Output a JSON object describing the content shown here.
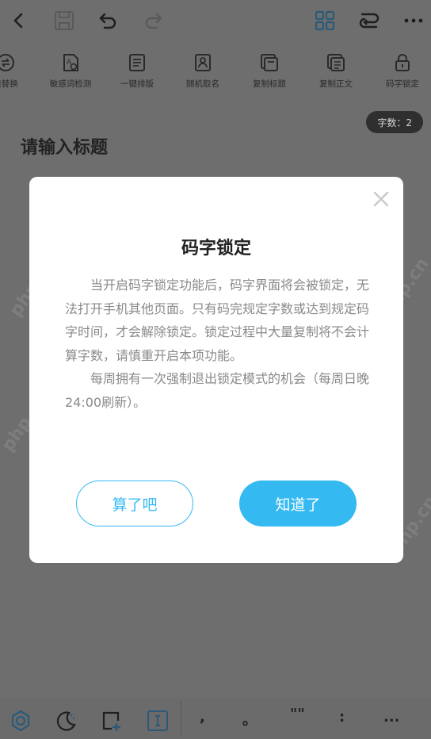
{
  "toolbar": {
    "items": [
      {
        "label": "能替换",
        "icon": "replace-icon"
      },
      {
        "label": "敏感词检测",
        "icon": "sensitive-word-icon"
      },
      {
        "label": "一键排版",
        "icon": "format-icon"
      },
      {
        "label": "随机取名",
        "icon": "random-name-icon"
      },
      {
        "label": "复制标题",
        "icon": "copy-title-icon"
      },
      {
        "label": "复制正文",
        "icon": "copy-body-icon"
      },
      {
        "label": "码字锁定",
        "icon": "lock-icon"
      }
    ]
  },
  "editor": {
    "word_count": "字数：2",
    "title_placeholder": "请输入标题"
  },
  "watermark": "php.cn",
  "dialog": {
    "title": "码字锁定",
    "paragraph1": "当开启码字锁定功能后，码字界面将会被锁定，无法打开手机其他页面。只有码完规定字数或达到规定码字时间，才会解除锁定。锁定过程中大量复制将不会计算字数，请慎重开启本项功能。",
    "paragraph2": "每周拥有一次强制退出锁定模式的机会（每周日晚24:00刷新）。",
    "cancel_label": "算了吧",
    "confirm_label": "知道了"
  },
  "bottom_bar": {
    "punctuation": [
      ",",
      "。",
      "\"\"",
      ":",
      "..."
    ]
  },
  "colors": {
    "accent": "#35b9f1",
    "overlay": "#6e6e6e"
  }
}
